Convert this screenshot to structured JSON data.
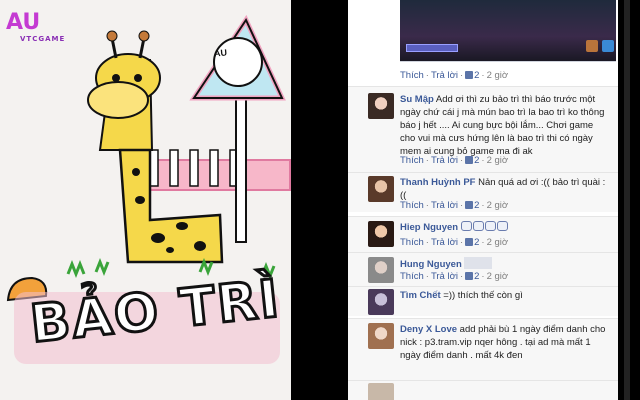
{
  "photo": {
    "logo_text": "AU",
    "logo_sub": "VTCGAME",
    "banner": "BẢO TRÌ",
    "sign_text": "AU"
  },
  "actions": {
    "like": "Thích",
    "reply": "Trả lời",
    "sep": "·"
  },
  "comments": [
    {
      "author": "",
      "text": "",
      "likes": "2",
      "time": "2 giờ"
    },
    {
      "author": "Su Mập",
      "text": "Add ơi thì zu bảo trì thì báo trước một ngày chứ cái j mà mún bao trì la bao trì ko thông báo j hết .... Ai cung bực bội lắm... Chơi game cho vui mà cưs hứng lên là bao trì thi có ngày mem ai cung bỏ game ma đi ak",
      "likes": "2",
      "time": "2 giờ"
    },
    {
      "author": "Thanh Huỳnh PF",
      "text": "Nản quá ad ơi :(( bảo trì quài :((",
      "likes": "2",
      "time": "2 giờ"
    },
    {
      "author": "Hiep Nguyen",
      "text": "",
      "likes": "2",
      "time": "2 giờ"
    },
    {
      "author": "Hung Nguyen",
      "text": "",
      "likes": "2",
      "time": "2 giờ"
    },
    {
      "author": "Tìm Chết",
      "text": "=)) thích thế còn gì",
      "likes": "",
      "time": ""
    },
    {
      "author": "Deny X Love",
      "text": "add phải bù 1 ngày điểm danh cho nick : p3.tram.vip nqer hông . tại ad mà mất 1 ngày điểm danh . mất 4k đen",
      "likes": "",
      "time": ""
    }
  ],
  "colors": {
    "link": "#3b5998",
    "meta": "#7f7f7f",
    "background": "#f7f7f7"
  }
}
